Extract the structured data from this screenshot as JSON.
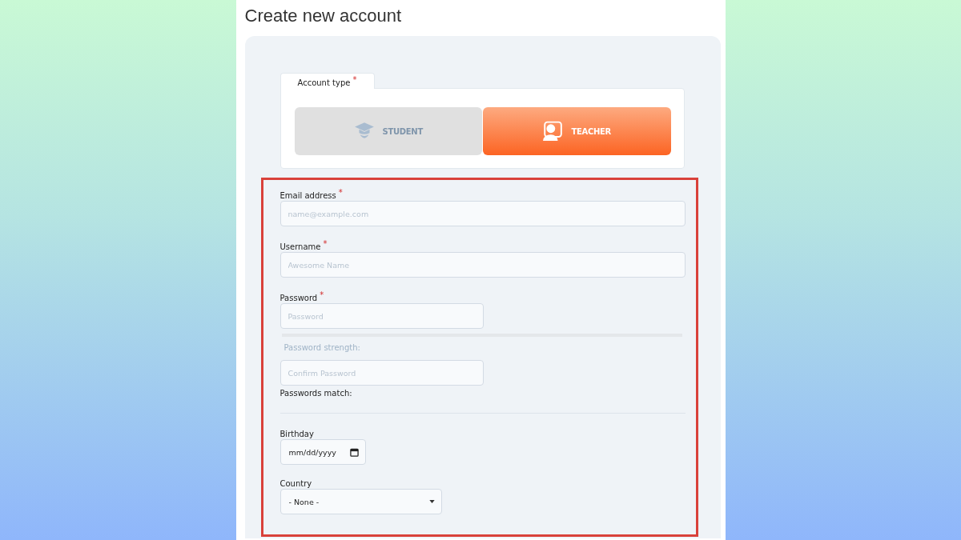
{
  "page": {
    "title": "Create new account"
  },
  "account_type": {
    "label": "Account type",
    "required_mark": "*",
    "options": [
      {
        "label": "STUDENT",
        "kind": "student",
        "selected": false
      },
      {
        "label": "TEACHER",
        "kind": "teacher",
        "selected": true
      }
    ]
  },
  "fields": [
    {
      "kind": "text",
      "label": "Email address",
      "required_mark": "*",
      "placeholder": "name@example.com"
    },
    {
      "kind": "text",
      "label": "Username",
      "required_mark": "*",
      "placeholder": "Awesome Name"
    },
    {
      "kind": "password",
      "label": "Password",
      "required_mark": "*",
      "placeholder": "Password",
      "strength_label": "Password strength:",
      "confirm_placeholder": "Confirm Password",
      "match_label": "Passwords match:"
    },
    {
      "kind": "divider"
    },
    {
      "kind": "date",
      "label": "Birthday",
      "placeholder": "mm/dd/yyyy"
    },
    {
      "kind": "select",
      "label": "Country",
      "value": "- None -"
    }
  ]
}
